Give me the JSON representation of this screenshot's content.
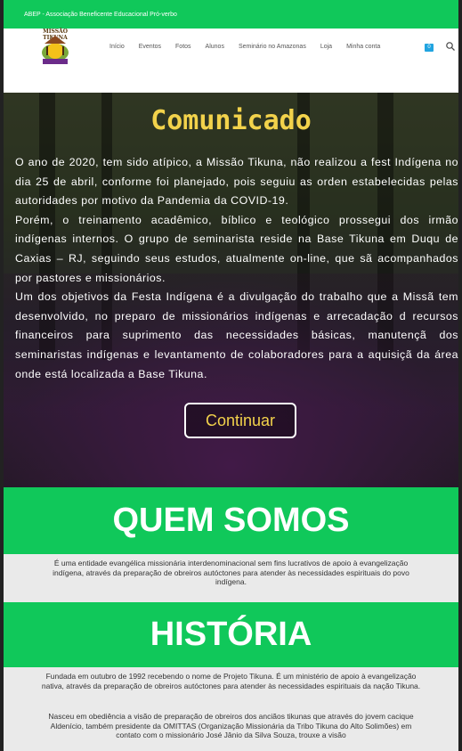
{
  "topbar": {
    "text": "ABEP - Associação Beneficente Educacional Pró-verbo"
  },
  "logo": {
    "title": "MISSÃO TIKUNA"
  },
  "nav": {
    "items": [
      "Início",
      "Eventos",
      "Fotos",
      "Alunos",
      "Seminário no Amazonas",
      "Loja",
      "Minha conta"
    ],
    "cart_count": "0"
  },
  "hero": {
    "title": "Comunicado",
    "body": "O ano de 2020, tem sido atípico, a Missão Tikuna, não realizou a fest Indígena no dia 25 de abril, conforme foi planejado, pois seguiu as orden estabelecidas pelas autoridades por motivo da Pandemia da COVID-19.\nPorém, o treinamento acadêmico, bíblico e teológico prossegui dos irmão indígenas internos. O grupo de seminarista reside na Base Tikuna em Duqu de Caxias – RJ, seguindo seus estudos, atualmente on-line, que sã acompanhados por pastores e missionários.\nUm dos objetivos da Festa Indígena é a divulgação do trabalho que a Missã tem desenvolvido, no preparo de missionários indígenas e arrecadação d recursos financeiros para suprimento das necessidades básicas, manutençã dos seminaristas indígenas e levantamento de colaboradores para a aquisiçã da área  onde está localizada a Base Tikuna.",
    "button": "Continuar"
  },
  "quem_somos": {
    "heading": "QUEM SOMOS",
    "text": "É uma entidade evangélica missionária interdenominacional sem fins lucrativos de apoio à evangelização indígena, através da preparação de obreiros autóctones para atender às necessidades espirituais do povo indígena."
  },
  "historia": {
    "heading": "HISTÓRIA",
    "p1": "Fundada em outubro de 1992 recebendo o nome de Projeto Tikuna. É um ministério de apoio à evangelização nativa, através da preparação de obreiros autóctones para atender às necessidades espirituais da nação Tikuna.",
    "p2": "Nasceu em obediência a visão de preparação de obreiros dos anciãos tikunas que através do jovem cacique Aldenício, também presidente da OMITTAS (Organização Missionária da Tribo Tikuna do Alto Solimões) em contato com o missionário José Jânio da Silva Souza, trouxe a visão"
  },
  "colors": {
    "green": "#10c85a",
    "gold": "#f2d24b",
    "cart_blue": "#21a4e0"
  }
}
